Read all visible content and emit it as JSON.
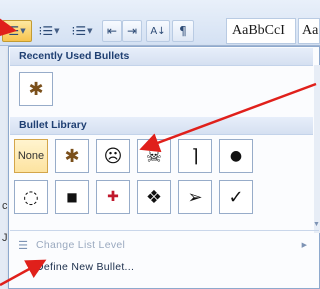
{
  "ribbon": {
    "buttons": [
      {
        "id": "bullets",
        "icon": "bullets-icon",
        "glyph": "☰"
      },
      {
        "id": "numbering",
        "icon": "numbering-icon",
        "glyph": "⁝☰"
      },
      {
        "id": "multilevel",
        "icon": "multilevel-list-icon",
        "glyph": "⁝☰"
      },
      {
        "id": "decrease-indent",
        "icon": "decrease-indent-icon",
        "glyph": "⇤"
      },
      {
        "id": "increase-indent",
        "icon": "increase-indent-icon",
        "glyph": "⇥"
      },
      {
        "id": "sort",
        "icon": "sort-icon",
        "glyph": "A↓"
      },
      {
        "id": "show-marks",
        "icon": "pilcrow-icon",
        "glyph": "¶"
      }
    ],
    "style_samples": [
      "AaBbCcI",
      "Aa"
    ]
  },
  "dropdown": {
    "recent_header": "Recently Used Bullets",
    "recent": [
      {
        "icon": "bug-bullet-icon",
        "glyph": "✱"
      }
    ],
    "library_header": "Bullet Library",
    "library": [
      {
        "label": "None",
        "icon": "none-bullet"
      },
      {
        "icon": "bug-bullet-icon",
        "glyph": "✱"
      },
      {
        "icon": "frown-face-bullet-icon",
        "glyph": "☹"
      },
      {
        "icon": "skull-crossbones-bullet-icon",
        "glyph": "☠"
      },
      {
        "icon": "bracket-bullet-icon",
        "glyph": "⌉"
      },
      {
        "icon": "round-bullet-icon",
        "glyph": "●"
      },
      {
        "icon": "hollow-circle-bullet-icon",
        "glyph": "◌"
      },
      {
        "icon": "square-bullet-icon",
        "glyph": "■"
      },
      {
        "icon": "pushpin-bullet-icon",
        "glyph": "✚"
      },
      {
        "icon": "diamond-dots-bullet-icon",
        "glyph": "❖"
      },
      {
        "icon": "arrowhead-bullet-icon",
        "glyph": "➢"
      },
      {
        "icon": "checkmark-bullet-icon",
        "glyph": "✓"
      }
    ],
    "menu": {
      "change_level": "Change List Level",
      "define_new": "Define New Bullet..."
    }
  },
  "colors": {
    "annotation_arrow": "#e0201b",
    "highlight": "#fbd977"
  }
}
